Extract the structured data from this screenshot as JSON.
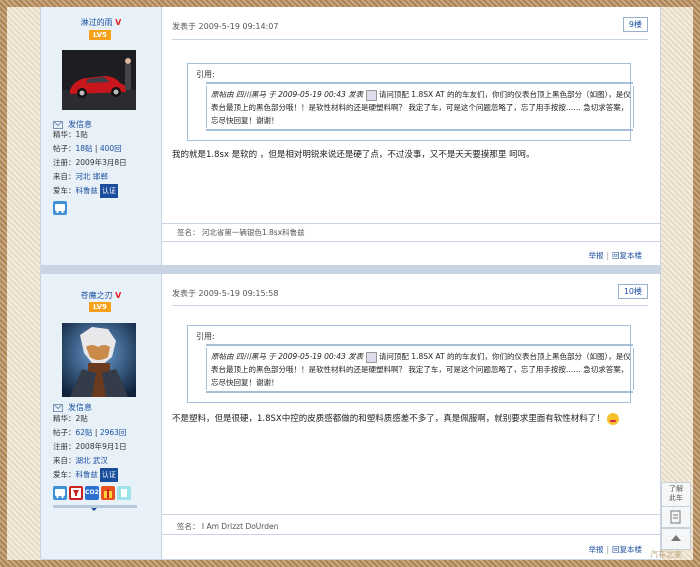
{
  "posts": [
    {
      "username": "淋过的雨",
      "v_mark": "V",
      "level": "LV5",
      "send_message": "发信息",
      "info": {
        "essence": "精华：1贴",
        "posts_label": "帖子：",
        "posts_count": "18贴",
        "replies_count": "400回",
        "registered": "注册：2009年3月8日",
        "from_label": "来自：",
        "from_value": "河北 邯郸",
        "car_label": "爱车：",
        "car_value": "科鲁兹",
        "cert": "认证"
      },
      "post_time": "发表于 2009-5-19 09:14:07",
      "floor": "9楼",
      "quote_label": "引用:",
      "quote_text": "原帖由 四川黑马 于 2009-05-19 00:43 发表",
      "quote_rest": "请问顶配 1.8SX AT 的的车友们，你们的仪表台顶上黑色部分（如图），是仪表台最顶上的黑色部分哦！！是软性材料的还是硬塑料啊？ 我定了车，可是这个问题忽略了，忘了用手按按…… 急切求答案，忘尽快回复！谢谢！",
      "body": "我的就是1.8sx 是软的 ，但是相对明锐来说还是硬了点，不过没事，又不是天天要摸那里 呵呵。",
      "signature": "签名： 河北省第一辆银色1.8sx科鲁兹",
      "report": "举报",
      "reply": "回复本楼"
    },
    {
      "username": "苍魔之刃",
      "v_mark": "V",
      "level": "LV9",
      "send_message": "发信息",
      "info": {
        "essence": "精华：2贴",
        "posts_label": "帖子：",
        "posts_count": "62贴",
        "replies_count": "2963回",
        "registered": "注册：2008年9月1日",
        "from_label": "来自：",
        "from_value": "湖北 武汉",
        "car_label": "爱车：",
        "car_value": "科鲁兹",
        "cert": "认证"
      },
      "post_time": "发表于 2009-5-19 09:15:58",
      "floor": "10楼",
      "quote_label": "引用:",
      "quote_text": "原帖由 四川黑马 于 2009-05-19 00:43 发表",
      "quote_rest": "请问顶配 1.8SX AT 的的车友们，你们的仪表台顶上黑色部分（如图），是仪表台最顶上的黑色部分哦！！是软性材料的还是硬塑料啊？ 我定了车，可是这个问题忽略了，忘了用手按按…… 急切求答案，忘尽快回复！谢谢！",
      "body": "不是塑料，但是很硬，1.8SX中控的皮质感都做的和塑料质感差不多了，真是佩服啊，就别要求里面有软性材料了！",
      "signature": "签名： I Am Drizzt DoUrden",
      "report": "举报",
      "reply": "回复本楼"
    }
  ],
  "medal_text": {
    "co2": "CO2"
  },
  "sidebar": {
    "learn_line1": "了解",
    "learn_line2": "此车"
  },
  "watermark": "汽车之家"
}
